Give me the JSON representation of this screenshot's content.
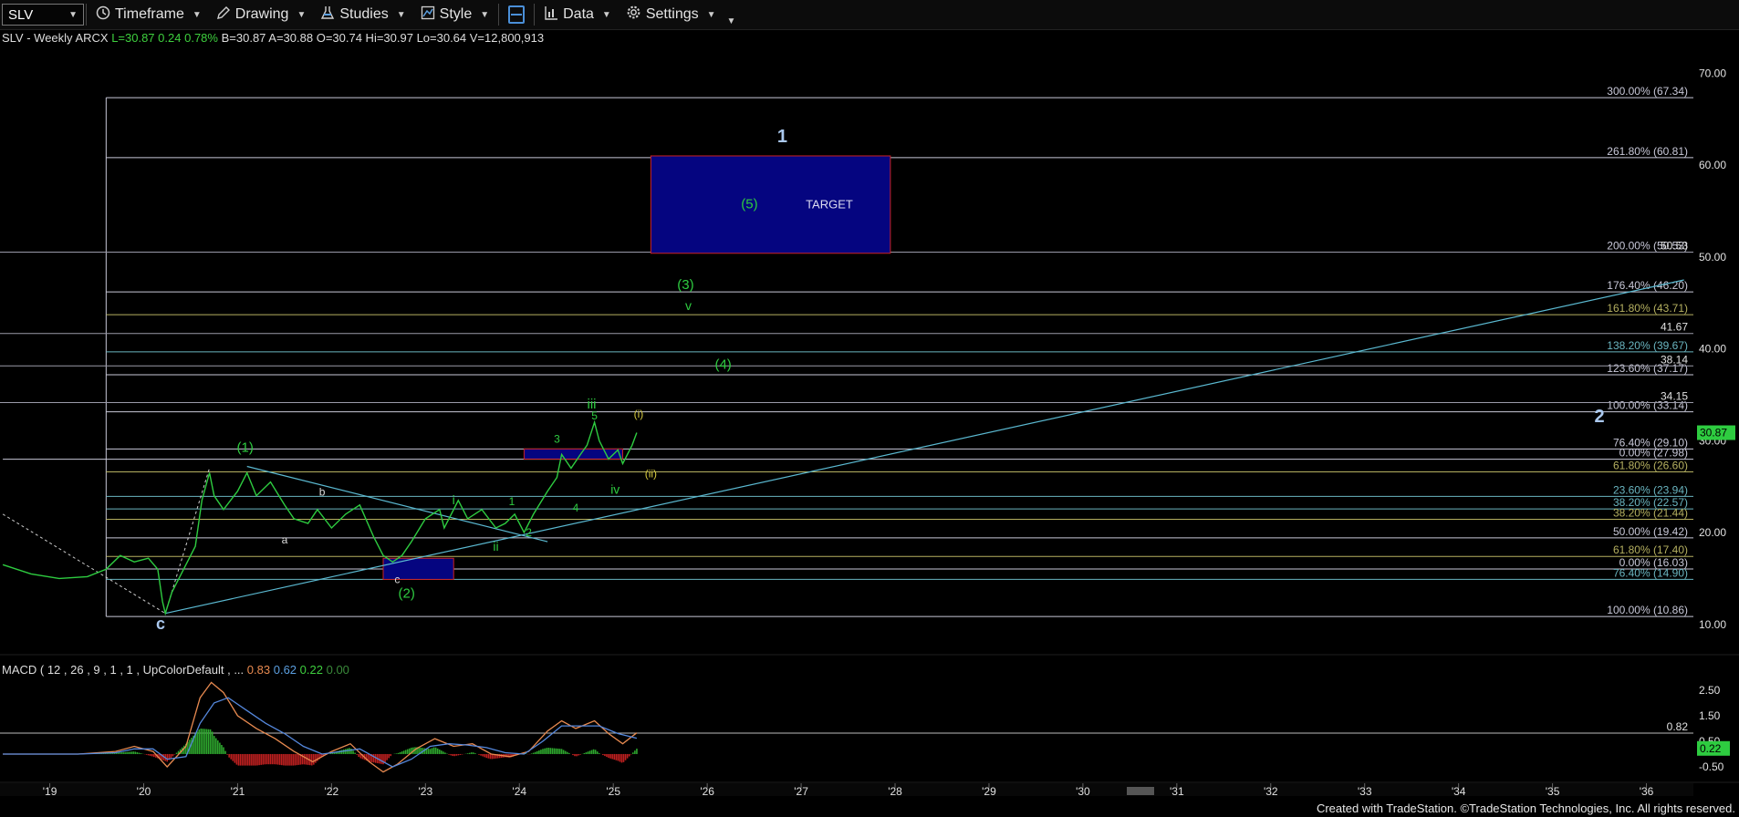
{
  "toolbar": {
    "symbol": "SLV",
    "items": [
      {
        "label": "Timeframe",
        "icon": "clock-icon"
      },
      {
        "label": "Drawing",
        "icon": "pencil-icon"
      },
      {
        "label": "Studies",
        "icon": "flask-icon"
      },
      {
        "label": "Style",
        "icon": "style-icon"
      },
      {
        "label": "",
        "icon": "layout-icon"
      },
      {
        "label": "Data",
        "icon": "bar-chart-icon"
      },
      {
        "label": "Settings",
        "icon": "gear-icon"
      }
    ]
  },
  "header": {
    "name": "SLV - Weekly  ARCX",
    "last": "L=30.87",
    "chg": "0.24",
    "pct": "0.78%",
    "rest": "B=30.87  A=30.88  O=30.74  Hi=30.97  Lo=30.64  V=12,800,913"
  },
  "macd_header": {
    "name": "MACD ( 12 , 26 , 9 , 1 , 1 , UpColorDefault , ...",
    "v1": "0.83",
    "v2": "0.62",
    "v3": "0.22",
    "v4": "0.00"
  },
  "footer": "Created with TradeStation. ©TradeStation Technologies, Inc. All rights reserved.",
  "colors": {
    "bg": "#000000",
    "price": "#2ecc40",
    "fib_white": "#c8c8d8",
    "fib_teal": "#6ab5c0",
    "fib_olive": "#b5b060",
    "trend": "#5ab8d0",
    "box_fill": "#050580",
    "box_border": "#cc2222",
    "macd_line": "#e88a50",
    "signal_line": "#5588dd"
  },
  "chart_data": {
    "type": "line",
    "title": "SLV - Weekly",
    "ylim": [
      7,
      74
    ],
    "price_ticks": [
      "70.00",
      "60.00",
      "50.00",
      "40.00",
      "30.00",
      "20.00",
      "10.00"
    ],
    "last_price": "30.87",
    "x_labels": [
      "'19",
      "'20",
      "'21",
      "'22",
      "'23",
      "'24",
      "'25",
      "'26",
      "'27",
      "'28",
      "'29",
      "'30",
      "'31",
      "'32",
      "'33",
      "'34",
      "'35",
      "'36"
    ],
    "series": [
      {
        "values": [
          [
            2018.5,
            16.5
          ],
          [
            2018.8,
            15.5
          ],
          [
            2019.1,
            15.0
          ],
          [
            2019.4,
            15.2
          ],
          [
            2019.6,
            16.0
          ],
          [
            2019.75,
            17.5
          ],
          [
            2019.9,
            16.8
          ],
          [
            2020.05,
            17.2
          ],
          [
            2020.15,
            16.0
          ],
          [
            2020.2,
            12.5
          ],
          [
            2020.23,
            11.2
          ],
          [
            2020.3,
            13.5
          ],
          [
            2020.45,
            16.5
          ],
          [
            2020.55,
            18.5
          ],
          [
            2020.62,
            23.5
          ],
          [
            2020.7,
            26.5
          ],
          [
            2020.75,
            24.0
          ],
          [
            2020.85,
            22.5
          ],
          [
            2021.0,
            24.5
          ],
          [
            2021.1,
            26.5
          ],
          [
            2021.2,
            24.0
          ],
          [
            2021.35,
            25.5
          ],
          [
            2021.5,
            23.0
          ],
          [
            2021.6,
            21.5
          ],
          [
            2021.75,
            21.0
          ],
          [
            2021.85,
            22.5
          ],
          [
            2022.0,
            20.5
          ],
          [
            2022.15,
            22.0
          ],
          [
            2022.3,
            23.0
          ],
          [
            2022.45,
            19.5
          ],
          [
            2022.55,
            17.5
          ],
          [
            2022.65,
            16.8
          ],
          [
            2022.75,
            17.5
          ],
          [
            2022.85,
            19.0
          ],
          [
            2023.0,
            21.5
          ],
          [
            2023.15,
            22.5
          ],
          [
            2023.2,
            20.5
          ],
          [
            2023.35,
            23.5
          ],
          [
            2023.45,
            21.5
          ],
          [
            2023.6,
            22.5
          ],
          [
            2023.75,
            20.5
          ],
          [
            2023.85,
            21.0
          ],
          [
            2023.95,
            22.0
          ],
          [
            2024.05,
            20.0
          ],
          [
            2024.15,
            22.0
          ],
          [
            2024.3,
            24.5
          ],
          [
            2024.4,
            26.0
          ],
          [
            2024.45,
            28.5
          ],
          [
            2024.55,
            27.0
          ],
          [
            2024.65,
            28.5
          ],
          [
            2024.72,
            29.5
          ],
          [
            2024.8,
            32.0
          ],
          [
            2024.85,
            30.0
          ],
          [
            2024.95,
            28.0
          ],
          [
            2025.05,
            29.0
          ],
          [
            2025.1,
            27.5
          ],
          [
            2025.2,
            29.5
          ],
          [
            2025.25,
            30.87
          ]
        ]
      }
    ],
    "fib_levels": [
      {
        "label": "300.00% (67.34)",
        "value": 67.34,
        "color": "white",
        "x1": 2019.6
      },
      {
        "label": "261.80% (60.81)",
        "value": 60.81,
        "color": "white",
        "x1": 2019.6
      },
      {
        "label": "200.00% (50.53)",
        "value": 50.53,
        "color": "white",
        "x1": 2018.5
      },
      {
        "label": "176.40% (46.20)",
        "value": 46.2,
        "color": "white",
        "x1": 2019.6
      },
      {
        "label": "161.80% (43.71)",
        "value": 43.71,
        "color": "olive",
        "x1": 2019.6
      },
      {
        "label": "138.20% (39.67)",
        "value": 39.67,
        "color": "teal",
        "x1": 2019.6
      },
      {
        "label": "123.60% (37.17)",
        "value": 37.17,
        "color": "white",
        "x1": 2019.6
      },
      {
        "label": "100.00% (33.14)",
        "value": 33.14,
        "color": "white",
        "x1": 2019.6
      },
      {
        "label": "76.40% (29.10)",
        "value": 29.1,
        "color": "white",
        "x1": 2019.6
      },
      {
        "label": "0.00% (27.98)",
        "value": 27.98,
        "color": "white",
        "x1": 2018.5
      },
      {
        "label": "61.80% (26.60)",
        "value": 26.6,
        "color": "olive",
        "x1": 2019.6
      },
      {
        "label": "23.60% (23.94)",
        "value": 23.94,
        "color": "teal",
        "x1": 2019.6
      },
      {
        "label": "38.20% (22.57)",
        "value": 22.57,
        "color": "teal",
        "x1": 2019.6
      },
      {
        "label": "38.20% (21.44)",
        "value": 21.44,
        "color": "olive",
        "x1": 2019.6
      },
      {
        "label": "50.00% (19.42)",
        "value": 19.42,
        "color": "white",
        "x1": 2019.6
      },
      {
        "label": "61.80% (17.40)",
        "value": 17.4,
        "color": "olive",
        "x1": 2019.6
      },
      {
        "label": "0.00% (16.03)",
        "value": 16.03,
        "color": "white",
        "x1": 2019.6
      },
      {
        "label": "76.40% (14.90)",
        "value": 14.9,
        "color": "teal",
        "x1": 2019.6
      },
      {
        "label": "100.00% (10.86)",
        "value": 10.86,
        "color": "white",
        "x1": 2019.6
      }
    ],
    "plain_levels": [
      {
        "label": "50.53",
        "value": 50.53
      },
      {
        "label": "41.67",
        "value": 41.67
      },
      {
        "label": "38.14",
        "value": 38.14
      },
      {
        "label": "34.15",
        "value": 34.15
      }
    ],
    "boxes": [
      {
        "x1": 2025.4,
        "x2": 2027.95,
        "y1": 50.4,
        "y2": 61.0,
        "label": "TARGET"
      },
      {
        "x1": 2022.55,
        "x2": 2023.3,
        "y1": 14.9,
        "y2": 17.2,
        "label": ""
      },
      {
        "x1": 2024.05,
        "x2": 2025.1,
        "y1": 28.0,
        "y2": 29.1,
        "label": ""
      }
    ],
    "trendlines": [
      {
        "x1": 2020.23,
        "y1": 11.2,
        "x2": 2036.4,
        "y2": 47.5,
        "color": "trend"
      },
      {
        "x1": 2021.1,
        "y1": 27.2,
        "x2": 2024.3,
        "y2": 19.0,
        "color": "trend"
      }
    ],
    "dashed_lines": [
      {
        "x1": 2018.5,
        "y1": 22.0,
        "x2": 2020.23,
        "y2": 11.2
      },
      {
        "x1": 2020.23,
        "y1": 11.2,
        "x2": 2020.7,
        "y2": 27.0
      }
    ],
    "wave_labels": [
      {
        "text": "1",
        "x": 2026.8,
        "y": 62.5,
        "color": "#aac8ee",
        "size": 20
      },
      {
        "text": "(5)",
        "x": 2026.45,
        "y": 55.3,
        "color": "#2ecc40",
        "size": 15
      },
      {
        "text": "TARGET",
        "x": 2027.3,
        "y": 55.3,
        "color": "#dcdcf0",
        "size": 13
      },
      {
        "text": "(3)",
        "x": 2025.77,
        "y": 46.5,
        "color": "#2ecc40",
        "size": 15
      },
      {
        "text": "v",
        "x": 2025.8,
        "y": 44.2,
        "color": "#2ecc40",
        "size": 14
      },
      {
        "text": "(4)",
        "x": 2026.17,
        "y": 37.8,
        "color": "#2ecc40",
        "size": 15
      },
      {
        "text": "2",
        "x": 2035.5,
        "y": 32.0,
        "color": "#aac8ee",
        "size": 20
      },
      {
        "text": "(1)",
        "x": 2021.08,
        "y": 28.8,
        "color": "#2ecc40",
        "size": 15
      },
      {
        "text": "b",
        "x": 2021.9,
        "y": 24.0,
        "color": "#dddddd",
        "size": 12
      },
      {
        "text": "a",
        "x": 2021.5,
        "y": 18.8,
        "color": "#dddddd",
        "size": 12
      },
      {
        "text": "c",
        "x": 2022.7,
        "y": 14.5,
        "color": "#dddddd",
        "size": 12
      },
      {
        "text": "(2)",
        "x": 2022.8,
        "y": 12.9,
        "color": "#2ecc40",
        "size": 15
      },
      {
        "text": "c",
        "x": 2020.18,
        "y": 9.5,
        "color": "#aac8ee",
        "size": 18
      },
      {
        "text": "i",
        "x": 2023.3,
        "y": 23.1,
        "color": "#2ecc40",
        "size": 14
      },
      {
        "text": "ii",
        "x": 2023.75,
        "y": 18.0,
        "color": "#2ecc40",
        "size": 14
      },
      {
        "text": "1",
        "x": 2023.92,
        "y": 23.0,
        "color": "#2ecc40",
        "size": 12
      },
      {
        "text": "2",
        "x": 2024.1,
        "y": 19.6,
        "color": "#2ecc40",
        "size": 12
      },
      {
        "text": "3",
        "x": 2024.4,
        "y": 29.8,
        "color": "#2ecc40",
        "size": 12
      },
      {
        "text": "4",
        "x": 2024.6,
        "y": 22.3,
        "color": "#2ecc40",
        "size": 12
      },
      {
        "text": "iii",
        "x": 2024.77,
        "y": 33.5,
        "color": "#2ecc40",
        "size": 15
      },
      {
        "text": "5",
        "x": 2024.8,
        "y": 32.3,
        "color": "#2ecc40",
        "size": 12
      },
      {
        "text": "iv",
        "x": 2025.02,
        "y": 24.2,
        "color": "#2ecc40",
        "size": 14
      },
      {
        "text": "(i)",
        "x": 2025.27,
        "y": 32.5,
        "color": "#d4c840",
        "size": 12
      },
      {
        "text": "(ii)",
        "x": 2025.4,
        "y": 26.0,
        "color": "#d4c840",
        "size": 12
      }
    ],
    "macd": {
      "ylim": [
        -1.0,
        3.1
      ],
      "ticks": [
        "2.50",
        "1.50",
        "0.50",
        "-0.50"
      ],
      "level_label": "0.82",
      "level": 0.82,
      "last_label": "0.22",
      "macd_line": [
        [
          2018.5,
          0.0
        ],
        [
          2019.3,
          0.0
        ],
        [
          2019.7,
          0.1
        ],
        [
          2019.9,
          0.3
        ],
        [
          2020.1,
          0.1
        ],
        [
          2020.25,
          -0.5
        ],
        [
          2020.45,
          0.3
        ],
        [
          2020.6,
          2.2
        ],
        [
          2020.72,
          2.8
        ],
        [
          2020.85,
          2.4
        ],
        [
          2021.0,
          1.5
        ],
        [
          2021.2,
          1.0
        ],
        [
          2021.4,
          0.6
        ],
        [
          2021.6,
          0.1
        ],
        [
          2021.8,
          -0.3
        ],
        [
          2022.0,
          0.1
        ],
        [
          2022.2,
          0.4
        ],
        [
          2022.4,
          -0.3
        ],
        [
          2022.55,
          -0.7
        ],
        [
          2022.7,
          -0.4
        ],
        [
          2022.9,
          0.2
        ],
        [
          2023.1,
          0.6
        ],
        [
          2023.3,
          0.3
        ],
        [
          2023.5,
          0.4
        ],
        [
          2023.7,
          0.0
        ],
        [
          2023.9,
          -0.1
        ],
        [
          2024.1,
          0.1
        ],
        [
          2024.3,
          0.9
        ],
        [
          2024.45,
          1.3
        ],
        [
          2024.6,
          1.0
        ],
        [
          2024.8,
          1.3
        ],
        [
          2024.95,
          0.8
        ],
        [
          2025.1,
          0.4
        ],
        [
          2025.25,
          0.83
        ]
      ],
      "signal_line": [
        [
          2018.5,
          0.0
        ],
        [
          2019.3,
          0.0
        ],
        [
          2019.7,
          0.05
        ],
        [
          2019.9,
          0.2
        ],
        [
          2020.1,
          0.2
        ],
        [
          2020.25,
          -0.2
        ],
        [
          2020.45,
          -0.1
        ],
        [
          2020.6,
          1.2
        ],
        [
          2020.75,
          2.0
        ],
        [
          2020.9,
          2.2
        ],
        [
          2021.1,
          1.7
        ],
        [
          2021.3,
          1.2
        ],
        [
          2021.5,
          0.8
        ],
        [
          2021.7,
          0.3
        ],
        [
          2021.9,
          0.0
        ],
        [
          2022.1,
          0.1
        ],
        [
          2022.3,
          0.2
        ],
        [
          2022.5,
          -0.2
        ],
        [
          2022.65,
          -0.5
        ],
        [
          2022.85,
          -0.2
        ],
        [
          2023.05,
          0.3
        ],
        [
          2023.25,
          0.4
        ],
        [
          2023.45,
          0.35
        ],
        [
          2023.65,
          0.25
        ],
        [
          2023.85,
          0.05
        ],
        [
          2024.05,
          0.0
        ],
        [
          2024.25,
          0.5
        ],
        [
          2024.45,
          1.1
        ],
        [
          2024.65,
          1.1
        ],
        [
          2024.85,
          1.1
        ],
        [
          2025.05,
          0.8
        ],
        [
          2025.25,
          0.62
        ]
      ]
    }
  }
}
